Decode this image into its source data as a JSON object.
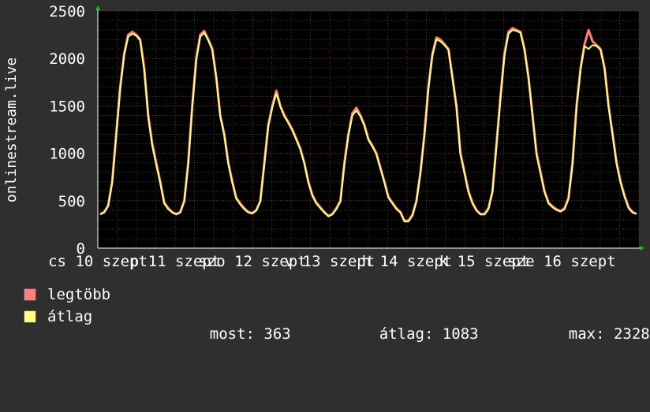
{
  "chart_data": {
    "type": "line",
    "ylabel": "onlinestream.live",
    "yticks": [
      0,
      500,
      1000,
      1500,
      2000,
      2500
    ],
    "ylim": [
      0,
      2500
    ],
    "xticks": [
      "cs 10 szept",
      "p 11 szept",
      "szo 12 szept",
      "v 13 szept",
      "h 14 szept",
      "k 15 szept",
      "sze 16 szept"
    ],
    "grid": true,
    "legend_placement": "bottom",
    "series": [
      {
        "name": "legtöbb",
        "color": "#ff7f7f",
        "values": [
          360,
          380,
          450,
          700,
          1200,
          1700,
          2050,
          2250,
          2280,
          2250,
          2200,
          1900,
          1400,
          1100,
          900,
          700,
          480,
          420,
          380,
          360,
          380,
          500,
          900,
          1500,
          2000,
          2250,
          2290,
          2200,
          2100,
          1800,
          1400,
          1200,
          900,
          700,
          530,
          470,
          420,
          380,
          370,
          400,
          500,
          900,
          1300,
          1500,
          1660,
          1500,
          1400,
          1330,
          1250,
          1150,
          1050,
          900,
          700,
          560,
          480,
          430,
          380,
          340,
          360,
          420,
          500,
          900,
          1200,
          1420,
          1480,
          1400,
          1300,
          1150,
          1080,
          1000,
          850,
          700,
          540,
          480,
          420,
          380,
          290,
          290,
          350,
          500,
          800,
          1200,
          1700,
          2050,
          2220,
          2200,
          2150,
          2100,
          1800,
          1500,
          1000,
          800,
          600,
          480,
          400,
          360,
          360,
          420,
          600,
          1100,
          1600,
          2050,
          2280,
          2320,
          2300,
          2280,
          2100,
          1800,
          1400,
          1000,
          800,
          600,
          480,
          440,
          410,
          390,
          420,
          530,
          900,
          1500,
          1900,
          2150,
          2300,
          2180,
          2140,
          2100,
          1900,
          1500,
          1200,
          900,
          700,
          550,
          430,
          380,
          360
        ],
        "style": "spiky"
      },
      {
        "name": "átlag",
        "color": "#ffff80",
        "values": [
          355,
          375,
          440,
          690,
          1180,
          1680,
          2030,
          2230,
          2260,
          2240,
          2190,
          1880,
          1380,
          1080,
          880,
          690,
          470,
          410,
          375,
          355,
          375,
          490,
          880,
          1480,
          1980,
          2230,
          2270,
          2190,
          2090,
          1790,
          1390,
          1190,
          890,
          690,
          520,
          460,
          410,
          375,
          365,
          395,
          490,
          880,
          1280,
          1480,
          1630,
          1490,
          1390,
          1320,
          1240,
          1140,
          1040,
          890,
          690,
          550,
          470,
          420,
          375,
          335,
          355,
          410,
          490,
          880,
          1180,
          1400,
          1450,
          1390,
          1290,
          1140,
          1070,
          990,
          840,
          690,
          530,
          470,
          410,
          375,
          280,
          280,
          340,
          490,
          790,
          1180,
          1680,
          2030,
          2200,
          2180,
          2140,
          2090,
          1790,
          1490,
          990,
          790,
          590,
          470,
          395,
          355,
          355,
          410,
          590,
          1080,
          1580,
          2030,
          2260,
          2300,
          2290,
          2270,
          2090,
          1790,
          1390,
          990,
          790,
          590,
          470,
          430,
          400,
          385,
          410,
          520,
          880,
          1480,
          1880,
          2130,
          2100,
          2140,
          2130,
          2090,
          1890,
          1490,
          1190,
          890,
          690,
          540,
          420,
          375,
          363
        ]
      }
    ],
    "stats": {
      "most_label": "most:",
      "most_value": "363",
      "atlag_label": "átlag:",
      "atlag_value": "1083",
      "max_label": "max:",
      "max_value": "2328"
    }
  }
}
